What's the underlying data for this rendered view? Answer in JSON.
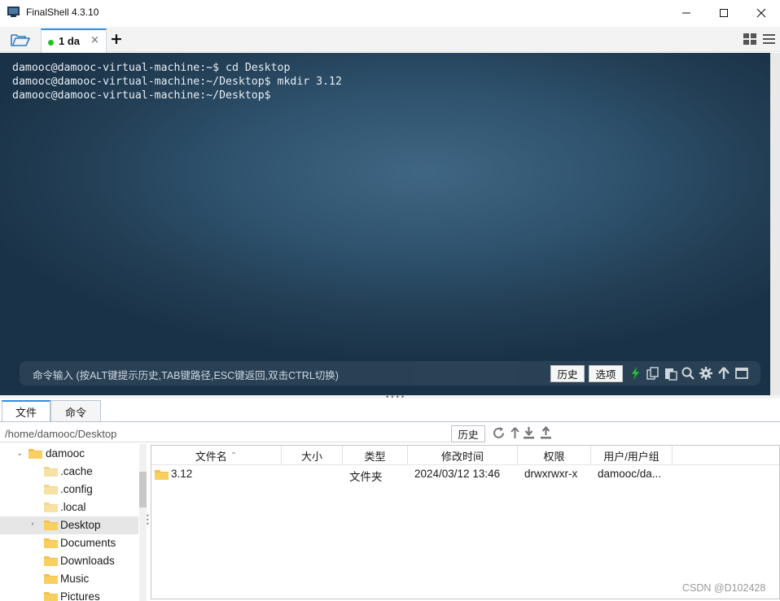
{
  "window": {
    "title": "FinalShell 4.3.10"
  },
  "tabbar": {
    "tab_label": "1 da",
    "tab_close": "×",
    "new_tab": "+"
  },
  "terminal": {
    "lines": [
      "damooc@damooc-virtual-machine:~$ cd Desktop",
      "damooc@damooc-virtual-machine:~/Desktop$ mkdir 3.12",
      "damooc@damooc-virtual-machine:~/Desktop$"
    ]
  },
  "cmdbar": {
    "hint": "命令输入 (按ALT键提示历史,TAB键路径,ESC键返回,双击CTRL切换)",
    "history_label": "历史",
    "options_label": "选项"
  },
  "panel_tabs": {
    "files": "文件",
    "commands": "命令"
  },
  "pathbar": {
    "path": "/home/damooc/Desktop",
    "history_label": "历史"
  },
  "tree": {
    "items": [
      {
        "label": "damooc"
      },
      {
        "label": ".cache"
      },
      {
        "label": ".config"
      },
      {
        "label": ".local"
      },
      {
        "label": "Desktop"
      },
      {
        "label": "Documents"
      },
      {
        "label": "Downloads"
      },
      {
        "label": "Music"
      },
      {
        "label": "Pictures"
      }
    ]
  },
  "files": {
    "columns": [
      "文件名",
      "大小",
      "类型",
      "修改时间",
      "权限",
      "用户/用户组"
    ],
    "rows": [
      {
        "name": "3.12",
        "size": "",
        "type": "文件夹",
        "modified": "2024/03/12 13:46",
        "permissions": "drwxrwxr-x",
        "owner": "damooc/da..."
      }
    ]
  },
  "watermark": "CSDN @D102428",
  "colors": {
    "accent": "#2f8fe0",
    "status_green": "#1cc41c",
    "folder": "#f5c04a"
  }
}
